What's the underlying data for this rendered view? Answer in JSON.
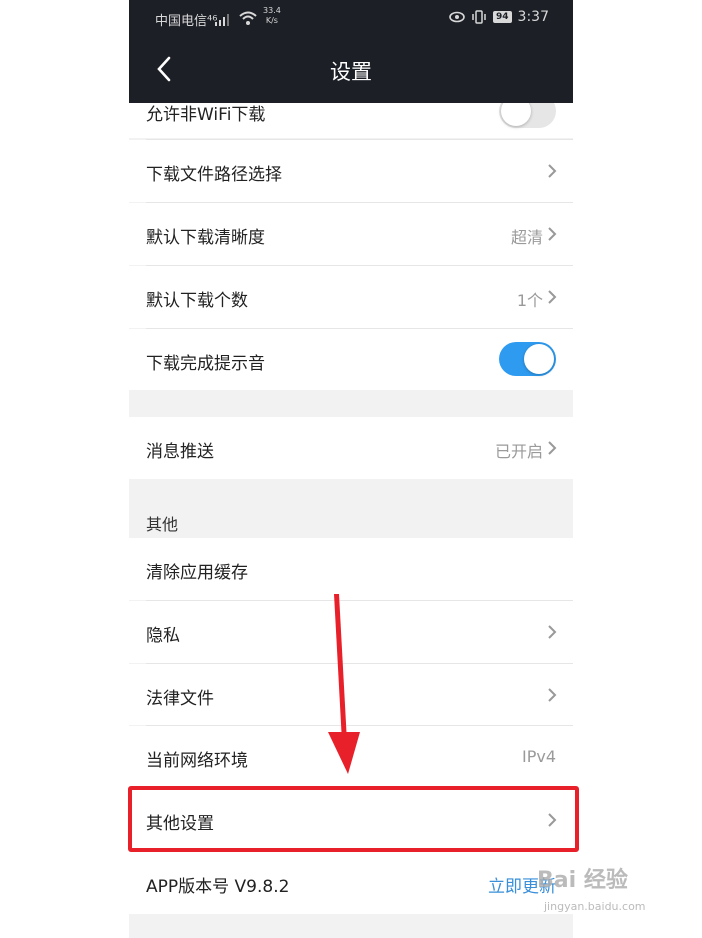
{
  "status_bar": {
    "carrier": "中国电信⁴⁶",
    "speed_value": "33.4",
    "speed_unit": "K/s",
    "battery": "94",
    "time": "3:37"
  },
  "nav": {
    "title": "设置"
  },
  "download_section": {
    "items": [
      {
        "label": "允许非WiFi下载",
        "toggle_on": false
      },
      {
        "label": "下载文件路径选择",
        "value": ""
      },
      {
        "label": "默认下载清晰度",
        "value": "超清"
      },
      {
        "label": "默认下载个数",
        "value": "1个"
      },
      {
        "label": "下载完成提示音",
        "toggle_on": true
      }
    ]
  },
  "push_section": {
    "label": "消息推送",
    "value": "已开启"
  },
  "other_section": {
    "header": "其他",
    "items": [
      {
        "label": "清除应用缓存"
      },
      {
        "label": "隐私"
      },
      {
        "label": "法律文件"
      },
      {
        "label": "当前网络环境",
        "value": "IPv4"
      },
      {
        "label": "其他设置"
      }
    ]
  },
  "version": {
    "label": "APP版本号 V9.8.2",
    "action": "立即更新"
  },
  "watermark": {
    "text": "Bai 经验",
    "sub": "jingyan.baidu.com"
  },
  "colors": {
    "toggle_on": "#2f9bf0",
    "toggle_off": "#e6e6e6",
    "highlight": "#e8202a",
    "link": "#3a8fd9"
  }
}
